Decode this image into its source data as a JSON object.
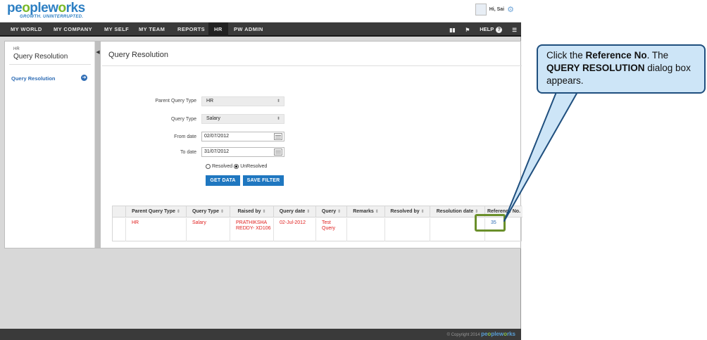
{
  "header": {
    "logo_text": "peopleworks",
    "logo_tagline": "GROWTH. UNINTERRUPTED.",
    "greeting": "Hi, Sai"
  },
  "nav": {
    "items": [
      "MY WORLD",
      "MY COMPANY",
      "MY SELF",
      "MY TEAM",
      "REPORTS",
      "HR",
      "PW ADMIN"
    ],
    "active": "HR",
    "help_label": "HELP"
  },
  "sidebar": {
    "breadcrumb": "HR",
    "title": "Query Resolution",
    "link": "Query Resolution"
  },
  "main": {
    "title": "Query Resolution",
    "form": {
      "parent_query_type_label": "Parent Query Type",
      "parent_query_type_value": "HR",
      "query_type_label": "Query Type",
      "query_type_value": "Salary",
      "from_date_label": "From date",
      "from_date_value": "02/07/2012",
      "to_date_label": "To date",
      "to_date_value": "31/07/2012",
      "resolved_label": "Resolved",
      "unresolved_label": "UnResolved",
      "selected_status": "UnResolved",
      "get_data_label": "GET DATA",
      "save_filter_label": "SAVE FILTER"
    },
    "table": {
      "columns": [
        "Parent Query Type",
        "Query Type",
        "Raised by",
        "Query date",
        "Query",
        "Remarks",
        "Resolved by",
        "Resolution date",
        "Reference No."
      ],
      "rows": [
        {
          "parent_query_type": "HR",
          "query_type": "Salary",
          "raised_by": "PRATHIKSHA REDDY- XD106",
          "query_date": "02-Jul-2012",
          "query": "Test Query",
          "remarks": "",
          "resolved_by": "",
          "resolution_date": "",
          "reference_no": "35"
        }
      ]
    }
  },
  "footer": {
    "copyright": "© Copyright 2014",
    "logo_text": "peopleworks"
  },
  "callout": {
    "pre": "Click the ",
    "bold1": "Reference No",
    "mid": ". The ",
    "bold2": "QUERY RESOLUTION",
    "post": " dialog box appears."
  },
  "colors": {
    "brand_blue": "#2d7fc3",
    "brand_green": "#7ab929",
    "nav_bg": "#3a3a3a",
    "button_blue": "#1f77c0",
    "row_text_red": "#e0201f",
    "link_blue": "#2f6db5",
    "callout_fill": "#cde5f7",
    "callout_border": "#1f4f7e",
    "highlight_green": "#6a8f2a"
  },
  "icons": [
    "user-avatar-icon",
    "gear-icon",
    "book-icon",
    "flag-icon",
    "help-icon",
    "menu-icon",
    "calendar-icon",
    "arrow-right-icon",
    "collapse-arrow-icon",
    "sort-icon"
  ]
}
